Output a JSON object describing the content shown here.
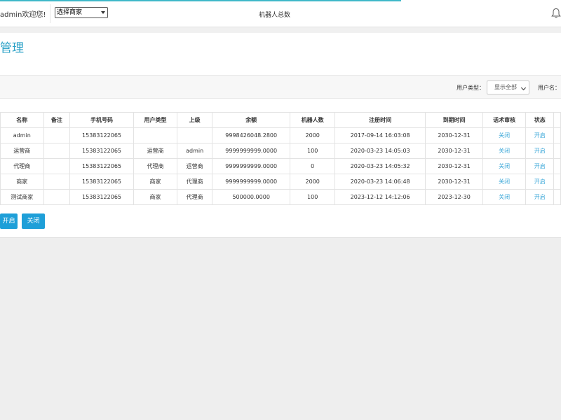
{
  "header": {
    "welcome": "admin欢迎您!",
    "merchant_select": "选择商家",
    "center_title": "机器人总数"
  },
  "page": {
    "title": "管理"
  },
  "filters": {
    "user_type_label": "用户类型：",
    "user_type_value": "显示全部",
    "username_label": "用户名："
  },
  "table": {
    "headers": [
      "名称",
      "备注",
      "手机号码",
      "用户类型",
      "上级",
      "余额",
      "机器人数",
      "注册时间",
      "到期时间",
      "话术审核",
      "状态",
      ""
    ],
    "rows": [
      [
        "admin",
        "",
        "15383122065",
        "",
        "",
        "9998426048.2800",
        "2000",
        "2017-09-14 16:03:08",
        "2030-12-31",
        "关闭",
        "开启",
        ""
      ],
      [
        "运营商",
        "",
        "15383122065",
        "运营商",
        "admin",
        "9999999999.0000",
        "100",
        "2020-03-23 14:05:03",
        "2030-12-31",
        "关闭",
        "开启",
        ""
      ],
      [
        "代理商",
        "",
        "15383122065",
        "代理商",
        "运营商",
        "9999999999.0000",
        "0",
        "2020-03-23 14:05:32",
        "2030-12-31",
        "关闭",
        "开启",
        ""
      ],
      [
        "商家",
        "",
        "15383122065",
        "商家",
        "代理商",
        "9999999999.0000",
        "2000",
        "2020-03-23 14:06:48",
        "2030-12-31",
        "关闭",
        "开启",
        ""
      ],
      [
        "测试商家",
        "",
        "15383122065",
        "商家",
        "代理商",
        "500000.0000",
        "100",
        "2023-12-12 14:12:06",
        "2023-12-30",
        "关闭",
        "开启",
        ""
      ]
    ]
  },
  "actions": {
    "open_label": "开启",
    "close_label": "关闭"
  },
  "colors": {
    "accent": "#29a0c6",
    "button": "#1e9fd8",
    "link": "#3aa7d8"
  }
}
